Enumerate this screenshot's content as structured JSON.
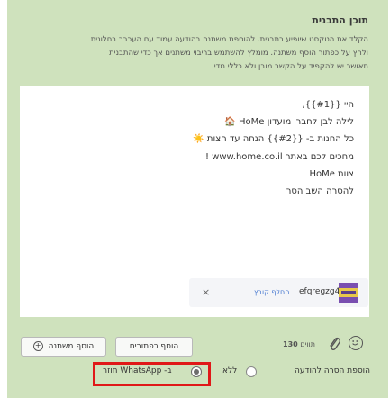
{
  "panel": {
    "title": "תוכן התבנית",
    "description_lines": [
      "הקלד את הטקסט שיופיע בתבנית. להוספת משתנה בהודעה עמוד עם העכבר בחלונית",
      "ולחץ על כפתור הוסף משתנה. מומלץ להשתמש בריבוי משתנים אך כדי שהתבנית",
      "תאושר יש להקפיד על הקשר מובן ולא כללי מדי."
    ]
  },
  "message": {
    "lines": [
      "היי {{#1}},",
      "לילה לבן לחברי מועדון HoMe 🏠",
      "כל החנות ב- {{#2}} הנחה עד חצות ☀️",
      "מחכים לכם באתר www.home.co.il !",
      "צוות HoMe",
      "להסרה השב הסר"
    ]
  },
  "attachment": {
    "name": "efqregzg4v",
    "change_label": "החלף קובץ",
    "close_glyph": "×"
  },
  "toolbar": {
    "char_count_label": "תווים",
    "char_count_value": "130",
    "add_buttons_label": "הוסף כפתורים",
    "add_variable_label": "הוסף משתנה",
    "emoji_icon": "smiley-icon",
    "attach_icon": "paperclip-icon"
  },
  "removal_option": {
    "label": "הוספת הסרה להודעה",
    "options": [
      {
        "label": "ללא",
        "selected": false
      },
      {
        "label": "ב- WhatsApp חוזר",
        "selected": true
      }
    ]
  },
  "colors": {
    "panel_bg": "#cfe2bd",
    "highlight": "#e01818",
    "link": "#4b7bd1"
  }
}
